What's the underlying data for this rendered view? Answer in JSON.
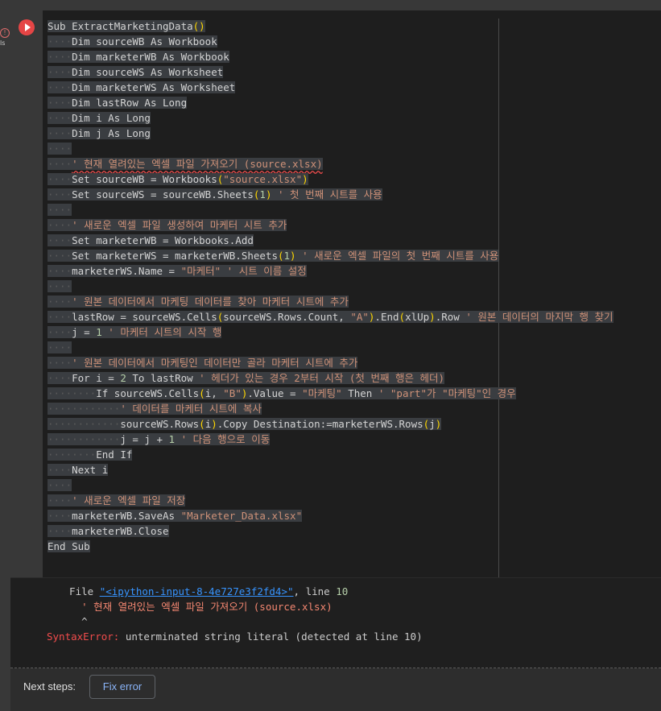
{
  "sidebar": {
    "warn_glyph": "!",
    "warn_label": "ls"
  },
  "code_lines": [
    [
      {
        "t": "Sub ExtractMarketingData"
      },
      {
        "t": "()",
        "c": "paren"
      }
    ],
    [
      {
        "t": "    ",
        "c": "indent"
      },
      {
        "t": "Dim sourceWB As Workbook"
      }
    ],
    [
      {
        "t": "    ",
        "c": "indent"
      },
      {
        "t": "Dim marketerWB As Workbook"
      }
    ],
    [
      {
        "t": "    ",
        "c": "indent"
      },
      {
        "t": "Dim sourceWS As Worksheet"
      }
    ],
    [
      {
        "t": "    ",
        "c": "indent"
      },
      {
        "t": "Dim marketerWS As Worksheet"
      }
    ],
    [
      {
        "t": "    ",
        "c": "indent"
      },
      {
        "t": "Dim lastRow As Long"
      }
    ],
    [
      {
        "t": "    ",
        "c": "indent"
      },
      {
        "t": "Dim i As Long"
      }
    ],
    [
      {
        "t": "    ",
        "c": "indent"
      },
      {
        "t": "Dim j As Long"
      }
    ],
    [
      {
        "t": "    ",
        "c": "indent"
      }
    ],
    [
      {
        "t": "    ",
        "c": "indent"
      },
      {
        "t": "' 현재 열려있는 엑셀 파일 가져오기 (source.xlsx)",
        "c": "cmt squig"
      }
    ],
    [
      {
        "t": "    ",
        "c": "indent"
      },
      {
        "t": "Set sourceWB = Workbooks"
      },
      {
        "t": "(",
        "c": "paren"
      },
      {
        "t": "\"source.xlsx\"",
        "c": "str"
      },
      {
        "t": ")",
        "c": "paren"
      }
    ],
    [
      {
        "t": "    ",
        "c": "indent"
      },
      {
        "t": "Set sourceWS = sourceWB.Sheets"
      },
      {
        "t": "(",
        "c": "paren"
      },
      {
        "t": "1",
        "c": "num"
      },
      {
        "t": ")",
        "c": "paren"
      },
      {
        "t": " ' 첫 번째 시트를 사용",
        "c": "cmt"
      }
    ],
    [
      {
        "t": "    ",
        "c": "indent"
      }
    ],
    [
      {
        "t": "    ",
        "c": "indent"
      },
      {
        "t": "' 새로운 엑셀 파일 생성하여 마케터 시트 추가",
        "c": "cmt"
      }
    ],
    [
      {
        "t": "    ",
        "c": "indent"
      },
      {
        "t": "Set marketerWB = Workbooks.Add"
      }
    ],
    [
      {
        "t": "    ",
        "c": "indent"
      },
      {
        "t": "Set marketerWS = marketerWB.Sheets"
      },
      {
        "t": "(",
        "c": "paren"
      },
      {
        "t": "1",
        "c": "num"
      },
      {
        "t": ")",
        "c": "paren"
      },
      {
        "t": " ' 새로운 엑셀 파일의 첫 번째 시트를 사용",
        "c": "cmt"
      }
    ],
    [
      {
        "t": "    ",
        "c": "indent"
      },
      {
        "t": "marketerWS.Name = "
      },
      {
        "t": "\"마케터\"",
        "c": "str"
      },
      {
        "t": " ' 시트 이름 설정",
        "c": "cmt"
      }
    ],
    [
      {
        "t": "    ",
        "c": "indent"
      }
    ],
    [
      {
        "t": "    ",
        "c": "indent"
      },
      {
        "t": "' 원본 데이터에서 마케팅 데이터를 찾아 마케터 시트에 추가",
        "c": "cmt"
      }
    ],
    [
      {
        "t": "    ",
        "c": "indent"
      },
      {
        "t": "lastRow = sourceWS.Cells"
      },
      {
        "t": "(",
        "c": "paren"
      },
      {
        "t": "sourceWS.Rows.Count, "
      },
      {
        "t": "\"A\"",
        "c": "str"
      },
      {
        "t": ")",
        "c": "paren"
      },
      {
        "t": ".End"
      },
      {
        "t": "(",
        "c": "paren"
      },
      {
        "t": "xlUp"
      },
      {
        "t": ")",
        "c": "paren"
      },
      {
        "t": ".Row"
      },
      {
        "t": " ' 원본 데이터의 마지막 행 찾기",
        "c": "cmt"
      }
    ],
    [
      {
        "t": "    ",
        "c": "indent"
      },
      {
        "t": "j = "
      },
      {
        "t": "1",
        "c": "num"
      },
      {
        "t": " ' 마케터 시트의 시작 행",
        "c": "cmt"
      }
    ],
    [
      {
        "t": "    ",
        "c": "indent"
      }
    ],
    [
      {
        "t": "    ",
        "c": "indent"
      },
      {
        "t": "' 원본 데이터에서 마케팅인 데이터만 골라 마케터 시트에 추가",
        "c": "cmt"
      }
    ],
    [
      {
        "t": "    ",
        "c": "indent"
      },
      {
        "t": "For i = "
      },
      {
        "t": "2",
        "c": "num"
      },
      {
        "t": " To lastRow"
      },
      {
        "t": " ' 헤더가 있는 경우 2부터 시작 (첫 번째 행은 헤더)",
        "c": "cmt"
      }
    ],
    [
      {
        "t": "        ",
        "c": "indent"
      },
      {
        "t": "If sourceWS.Cells"
      },
      {
        "t": "(",
        "c": "paren"
      },
      {
        "t": "i, "
      },
      {
        "t": "\"B\"",
        "c": "str"
      },
      {
        "t": ")",
        "c": "paren"
      },
      {
        "t": ".Value = "
      },
      {
        "t": "\"마케팅\"",
        "c": "str"
      },
      {
        "t": " Then"
      },
      {
        "t": " ' \"part\"가 \"마케팅\"인 경우",
        "c": "cmt"
      }
    ],
    [
      {
        "t": "            ",
        "c": "indent"
      },
      {
        "t": "' 데이터를 마케터 시트에 복사",
        "c": "cmt"
      }
    ],
    [
      {
        "t": "            ",
        "c": "indent"
      },
      {
        "t": "sourceWS.Rows"
      },
      {
        "t": "(",
        "c": "paren"
      },
      {
        "t": "i"
      },
      {
        "t": ")",
        "c": "paren"
      },
      {
        "t": ".Copy Destination:=marketerWS.Rows"
      },
      {
        "t": "(",
        "c": "paren"
      },
      {
        "t": "j"
      },
      {
        "t": ")",
        "c": "paren"
      }
    ],
    [
      {
        "t": "            ",
        "c": "indent"
      },
      {
        "t": "j = j + "
      },
      {
        "t": "1",
        "c": "num"
      },
      {
        "t": " ' 다음 행으로 이동",
        "c": "cmt"
      }
    ],
    [
      {
        "t": "        ",
        "c": "indent"
      },
      {
        "t": "End If"
      }
    ],
    [
      {
        "t": "    ",
        "c": "indent"
      },
      {
        "t": "Next i"
      }
    ],
    [
      {
        "t": "    ",
        "c": "indent"
      }
    ],
    [
      {
        "t": "    ",
        "c": "indent"
      },
      {
        "t": "' 새로운 엑셀 파일 저장",
        "c": "cmt"
      }
    ],
    [
      {
        "t": "    ",
        "c": "indent"
      },
      {
        "t": "marketerWB.SaveAs "
      },
      {
        "t": "\"Marketer_Data.xlsx\"",
        "c": "str"
      }
    ],
    [
      {
        "t": "    ",
        "c": "indent"
      },
      {
        "t": "marketerWB.Close"
      }
    ],
    [
      {
        "t": "End Sub"
      }
    ]
  ],
  "output": {
    "file_prefix": "  File ",
    "file_link": "\"<ipython-input-8-4e727e3f2fd4>\"",
    "line_text": ", line ",
    "line_no": "10",
    "offending_line": "    ' 현재 열려있는 엑셀 파일 가져오기 (source.xlsx)",
    "caret": "    ^",
    "error_type": "SyntaxError:",
    "error_message": " unterminated string literal (detected at line 10)"
  },
  "next_steps": {
    "label": "Next steps:",
    "fix_button": "Fix error"
  }
}
